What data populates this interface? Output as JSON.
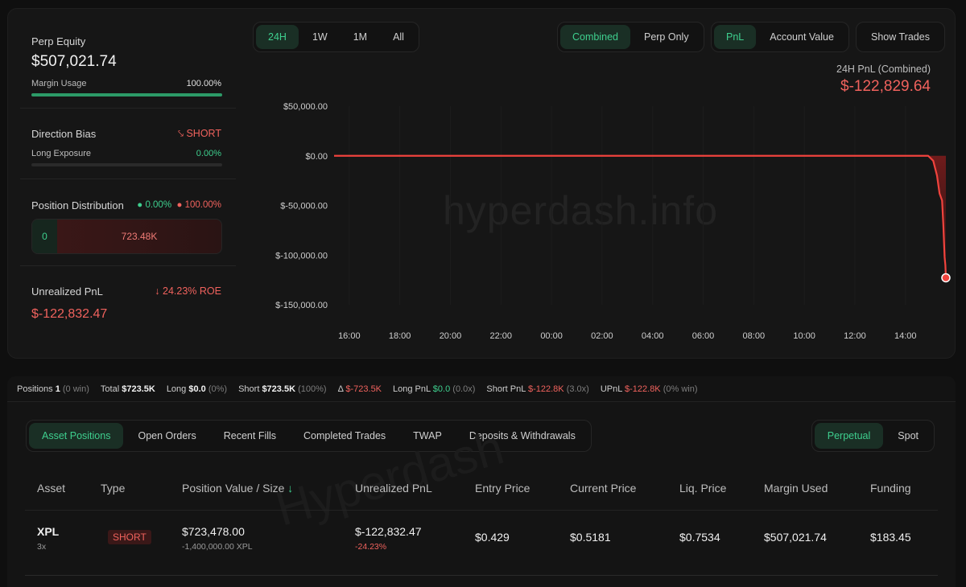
{
  "sidebar": {
    "equity_label": "Perp Equity",
    "equity_value": "$507,021.74",
    "margin_label": "Margin Usage",
    "margin_value": "100.00%",
    "margin_fraction": 1.0,
    "bias_label": "Direction Bias",
    "bias_value": "SHORT",
    "long_exposure_label": "Long Exposure",
    "long_exposure_value": "0.00%",
    "long_exposure_fraction": 0.0,
    "distribution_label": "Position Distribution",
    "dist_long_pct": "0.00%",
    "dist_short_pct": "100.00%",
    "dist_long_value": "0",
    "dist_short_value": "723.48K",
    "upnl_label": "Unrealized PnL",
    "roe_value": "24.23% ROE",
    "upnl_value": "$-122,832.47"
  },
  "range_tabs": [
    "24H",
    "1W",
    "1M",
    "All"
  ],
  "mode_tabs": [
    "Combined",
    "Perp Only"
  ],
  "metric_tabs": [
    "PnL",
    "Account Value"
  ],
  "show_trades_label": "Show Trades",
  "pnl_title": "24H PnL (Combined)",
  "pnl_value": "$-122,829.64",
  "watermark": "hyperdash.info",
  "watermark2": "Hyperdash",
  "chart_data": {
    "type": "line",
    "ylim": [
      -150000,
      50000
    ],
    "y_ticks": [
      50000,
      0,
      -50000,
      -100000,
      -150000
    ],
    "y_tick_labels": [
      "$50,000.00",
      "$0.00",
      "$-50,000.00",
      "$-100,000.00",
      "$-150,000.00"
    ],
    "x_ticks": [
      "16:00",
      "18:00",
      "20:00",
      "22:00",
      "00:00",
      "02:00",
      "04:00",
      "06:00",
      "08:00",
      "10:00",
      "12:00",
      "14:00"
    ],
    "x_tick_hours": [
      16,
      18,
      20,
      22,
      24,
      26,
      28,
      30,
      32,
      34,
      36,
      38
    ],
    "xlim_hours": [
      15.4,
      39.6
    ],
    "series": [
      {
        "color": "#f0433d",
        "points": [
          [
            15.4,
            0
          ],
          [
            38.9,
            0
          ],
          [
            39.1,
            -5000
          ],
          [
            39.25,
            -20000
          ],
          [
            39.35,
            -38000
          ],
          [
            39.45,
            -45000
          ],
          [
            39.5,
            -70000
          ],
          [
            39.55,
            -102000
          ],
          [
            39.58,
            -110000
          ],
          [
            39.6,
            -122829.64
          ]
        ]
      }
    ],
    "grid": true
  },
  "stats": {
    "positions_label": "Positions",
    "positions_value": "1",
    "positions_win": "(0 win)",
    "total_label": "Total",
    "total_value": "$723.5K",
    "long_label": "Long",
    "long_value": "$0.0",
    "long_pct": "(0%)",
    "short_label": "Short",
    "short_value": "$723.5K",
    "short_pct": "(100%)",
    "delta_label": "Δ",
    "delta_value": "$-723.5K",
    "longpnl_label": "Long PnL",
    "longpnl_value": "$0.0",
    "longpnl_x": "(0.0x)",
    "shortpnl_label": "Short PnL",
    "shortpnl_value": "$-122.8K",
    "shortpnl_x": "(3.0x)",
    "upnl_label": "UPnL",
    "upnl_value": "$-122.8K",
    "upnl_win": "(0% win)"
  },
  "bottom_tabs": [
    "Asset Positions",
    "Open Orders",
    "Recent Fills",
    "Completed Trades",
    "TWAP",
    "Deposits & Withdrawals"
  ],
  "type_tabs": [
    "Perpetual",
    "Spot"
  ],
  "table": {
    "headers": [
      "Asset",
      "Type",
      "Position Value / Size",
      "Unrealized PnL",
      "Entry Price",
      "Current Price",
      "Liq. Price",
      "Margin Used",
      "Funding"
    ],
    "row": {
      "asset": "XPL",
      "leverage": "3x",
      "type": "SHORT",
      "position_value": "$723,478.00",
      "position_size": "-1,400,000.00 XPL",
      "upnl": "$-122,832.47",
      "upnl_pct": "-24.23%",
      "entry_price": "$0.429",
      "current_price": "$0.5181",
      "liq_price": "$0.7534",
      "margin_used": "$507,021.74",
      "funding": "$183.45"
    }
  }
}
